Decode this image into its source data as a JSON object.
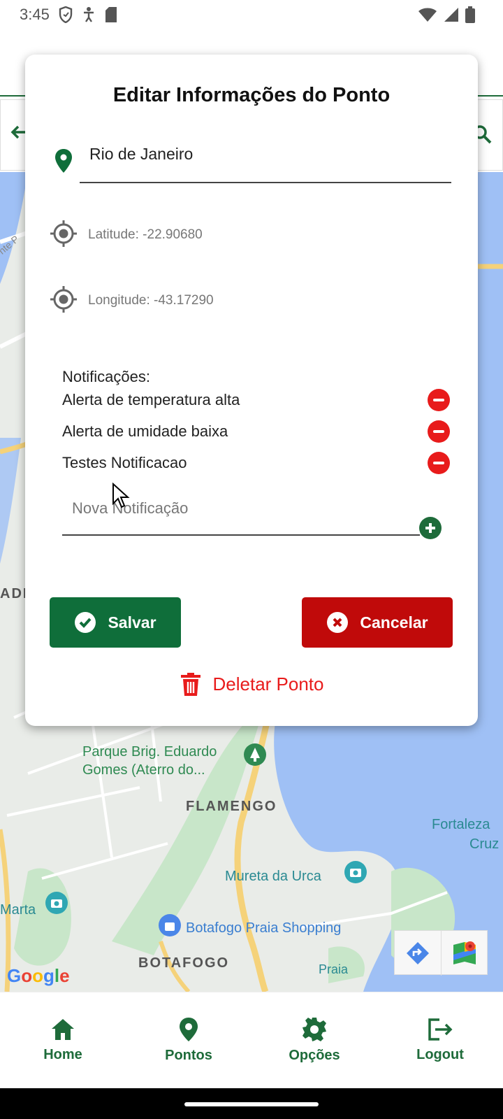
{
  "status_bar": {
    "time": "3:45",
    "icons_left": [
      "shield-icon",
      "accessibility-icon",
      "sd-card-icon"
    ],
    "icons_right": [
      "wifi-icon",
      "signal-icon",
      "battery-icon"
    ]
  },
  "map": {
    "labels": {
      "park": "Parque Brig. Eduardo\nGomes (Aterro do...",
      "flamengo": "FLAMENGO",
      "fortaleza_1": "Fortaleza",
      "fortaleza_2": "Cruz",
      "mureta": "Mureta da Urca",
      "marta": "Marta",
      "botafogo_shopping": "Botafogo Praia Shopping",
      "botafogo": "BOTAFOGO",
      "left_edge": "ADI",
      "praia": "Praia",
      "street_fragment": "nte P"
    },
    "google_logo": {
      "letters": [
        "G",
        "o",
        "o",
        "g",
        "l",
        "e"
      ],
      "colors": [
        "#4285F4",
        "#EA4335",
        "#FBBC05",
        "#4285F4",
        "#34A853",
        "#EA4335"
      ]
    },
    "water_color": "#9fc0f5",
    "road_color": "#f5d27a",
    "park_color": "#c8e6c9"
  },
  "modal": {
    "title": "Editar Informações do Ponto",
    "location_name": "Rio de Janeiro",
    "latitude_text": "Latitude: -22.90680",
    "longitude_text": "Longitude: -43.17290",
    "notifications_label": "Notificações:",
    "notifications": [
      {
        "text": "Alerta de temperatura alta"
      },
      {
        "text": "Alerta de umidade baixa"
      },
      {
        "text": "Testes Notificacao"
      }
    ],
    "new_notification_placeholder": "Nova Notificação",
    "save_label": "Salvar",
    "cancel_label": "Cancelar",
    "delete_label": "Deletar Ponto"
  },
  "bottom_nav": {
    "items": [
      {
        "label": "Home",
        "icon": "home-icon"
      },
      {
        "label": "Pontos",
        "icon": "location-pin-icon"
      },
      {
        "label": "Opções",
        "icon": "gear-icon"
      },
      {
        "label": "Logout",
        "icon": "logout-icon"
      }
    ]
  },
  "colors": {
    "primary_green": "#0f6e3a",
    "danger_red": "#c00a0a",
    "delete_red": "#e81b1b"
  }
}
